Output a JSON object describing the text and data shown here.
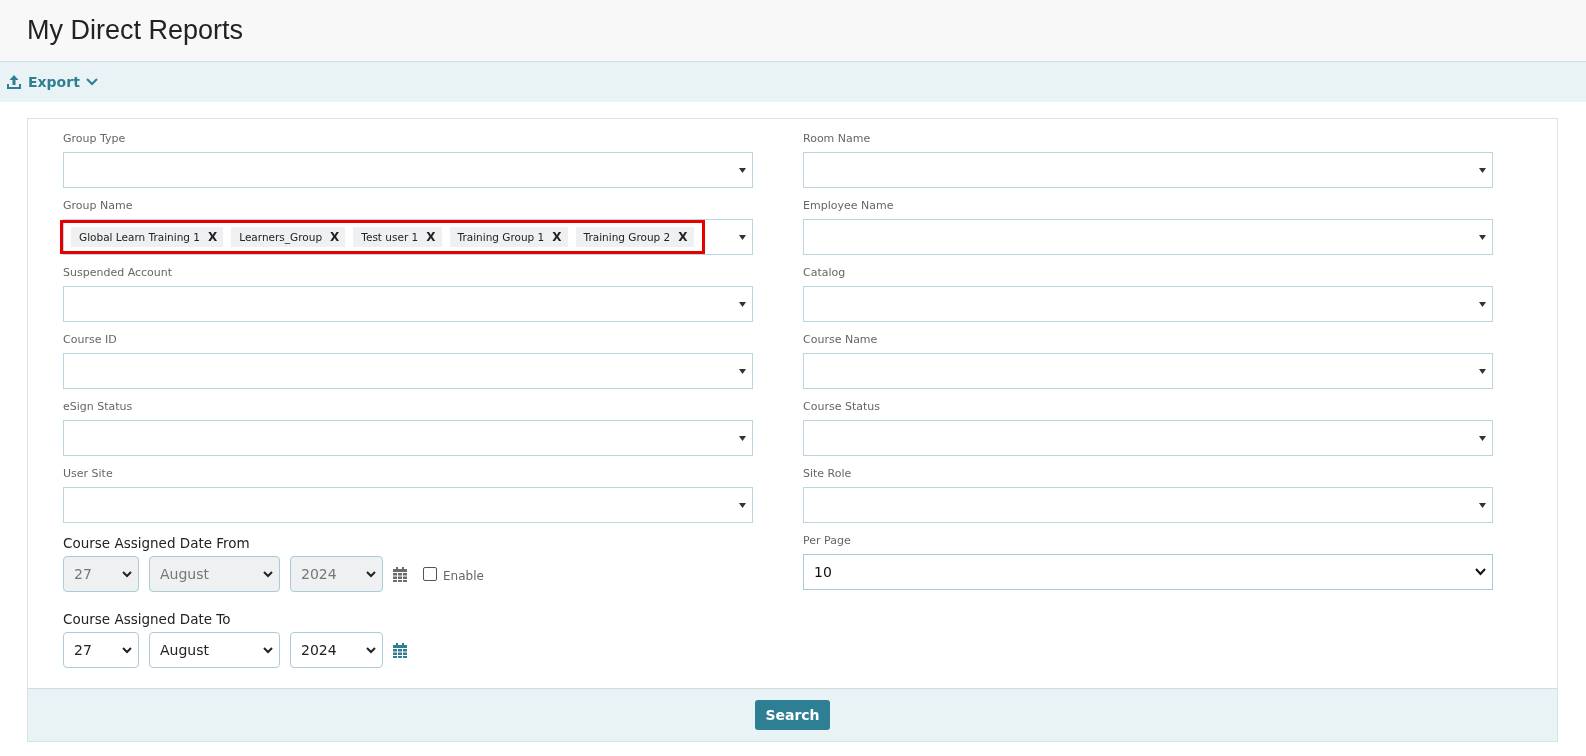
{
  "page_title": "My Direct Reports",
  "toolbar": {
    "export_label": "Export"
  },
  "left_fields": [
    {
      "label": "Group Type",
      "kind": "dropdown",
      "highlighted": false
    },
    {
      "label": "Group Name",
      "kind": "dropdown",
      "highlighted": true,
      "tags": [
        {
          "label": "Global Learn Training 1",
          "remove": "X"
        },
        {
          "label": "Learners_Group",
          "remove": "X"
        },
        {
          "label": "Test user 1",
          "remove": "X"
        },
        {
          "label": "Training Group 1",
          "remove": "X"
        },
        {
          "label": "Training Group 2",
          "remove": "X"
        }
      ]
    },
    {
      "label": "Suspended Account",
      "kind": "dropdown",
      "highlighted": false
    },
    {
      "label": "Course ID",
      "kind": "dropdown",
      "highlighted": false
    },
    {
      "label": "eSign Status",
      "kind": "dropdown",
      "highlighted": false
    },
    {
      "label": "User Site",
      "kind": "dropdown",
      "highlighted": false
    }
  ],
  "date_ranges": [
    {
      "label": "Course Assigned Date From",
      "day": "27",
      "month": "August",
      "year": "2024",
      "disabled": true,
      "enable": {
        "label": "Enable",
        "checked": false
      }
    },
    {
      "label": "Course Assigned Date To",
      "day": "27",
      "month": "August",
      "year": "2024",
      "disabled": false
    }
  ],
  "right_fields": [
    {
      "label": "Room Name",
      "kind": "dropdown"
    },
    {
      "label": "Employee Name",
      "kind": "dropdown"
    },
    {
      "label": "Catalog",
      "kind": "dropdown"
    },
    {
      "label": "Course Name",
      "kind": "dropdown"
    },
    {
      "label": "Course Status",
      "kind": "dropdown"
    },
    {
      "label": "Site Role",
      "kind": "dropdown"
    },
    {
      "label": "Per Page",
      "kind": "select",
      "value": "10"
    }
  ],
  "search_button": "Search"
}
